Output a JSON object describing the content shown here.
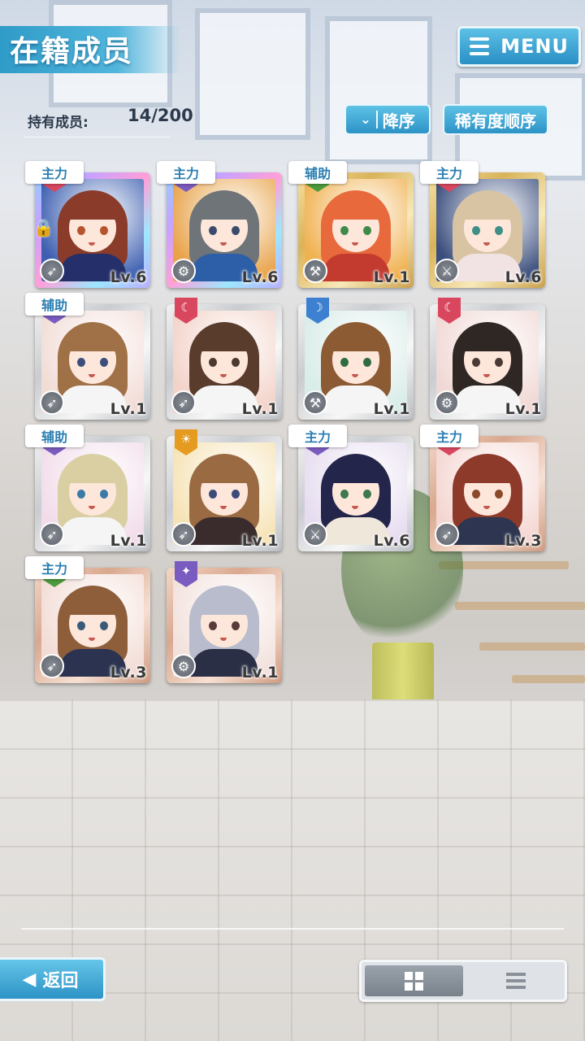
{
  "header": {
    "title": "在籍成员",
    "menu_label": "MENU",
    "owned_label": "持有成员:",
    "owned_count": "14/200",
    "sort_order_label": "降序",
    "sort_rarity_label": "稀有度顺序"
  },
  "members": [
    {
      "role": "主力",
      "level": "Lv.6",
      "frame": "rainbow",
      "attribute": "red",
      "weapon": "rocket-icon",
      "locked": true,
      "hair": "#8a3b2a",
      "eye": "#b5542d",
      "bg": "#3d5fb0",
      "outfit": "#25306a"
    },
    {
      "role": "主力",
      "level": "Lv.6",
      "frame": "rainbow",
      "attribute": "purple",
      "weapon": "gear-icon",
      "locked": false,
      "hair": "#6f7478",
      "eye": "#3b4b6b",
      "bg": "#e8a34a",
      "outfit": "#2d5fa8"
    },
    {
      "role": "辅助",
      "level": "Lv.1",
      "frame": "gold",
      "attribute": "green",
      "weapon": "hammer-icon",
      "locked": false,
      "hair": "#e86a3c",
      "eye": "#3e8a4a",
      "bg": "#f0b150",
      "outfit": "#c33b2f"
    },
    {
      "role": "主力",
      "level": "Lv.6",
      "frame": "gold",
      "attribute": "red",
      "weapon": "sword-icon",
      "locked": false,
      "hair": "#d8c4a2",
      "eye": "#3f8f86",
      "bg": "#3a4e7d",
      "outfit": "#f1e3e3"
    },
    {
      "role": "辅助",
      "level": "Lv.1",
      "frame": "silver",
      "attribute": "purple",
      "weapon": "rocket-icon",
      "locked": false,
      "hair": "#a07047",
      "eye": "#3d4e7c",
      "bg": "#f2dcd6",
      "outfit": "#f5f5f5"
    },
    {
      "role": "",
      "level": "Lv.1",
      "frame": "silver",
      "attribute": "red",
      "weapon": "rocket-icon",
      "locked": false,
      "hair": "#5a3c2d",
      "eye": "#4a3a32",
      "bg": "#f3d3c9",
      "outfit": "#f5f5f5"
    },
    {
      "role": "",
      "level": "Lv.1",
      "frame": "silver",
      "attribute": "blue",
      "weapon": "hammer-icon",
      "locked": false,
      "hair": "#8c5a33",
      "eye": "#2e6c3f",
      "bg": "#d8ece8",
      "outfit": "#f5f5f5"
    },
    {
      "role": "",
      "level": "Lv.1",
      "frame": "silver",
      "attribute": "red",
      "weapon": "gear-icon",
      "locked": false,
      "hair": "#2e2724",
      "eye": "#4b3a33",
      "bg": "#f0d8d4",
      "outfit": "#f5f5f5"
    },
    {
      "role": "辅助",
      "level": "Lv.1",
      "frame": "silver",
      "attribute": "purple",
      "weapon": "rocket-icon",
      "locked": false,
      "hair": "#d9cfa2",
      "eye": "#3b7aa8",
      "bg": "#f2dcea",
      "outfit": "#f5f5f5"
    },
    {
      "role": "",
      "level": "Lv.1",
      "frame": "silver",
      "attribute": "orange",
      "weapon": "rocket-icon",
      "locked": false,
      "hair": "#9a6a43",
      "eye": "#3b4b7a",
      "bg": "#f6e3b5",
      "outfit": "#3a2c2c"
    },
    {
      "role": "主力",
      "level": "Lv.6",
      "frame": "silver",
      "attribute": "purple",
      "weapon": "sword-icon",
      "locked": false,
      "hair": "#23264a",
      "eye": "#3c7a4e",
      "bg": "#e6dcf0",
      "outfit": "#efe7d9"
    },
    {
      "role": "主力",
      "level": "Lv.3",
      "frame": "bronze",
      "attribute": "red",
      "weapon": "rocket-icon",
      "locked": false,
      "hair": "#8e3a2a",
      "eye": "#8a4a2a",
      "bg": "#f4d6d1",
      "outfit": "#2d3550"
    },
    {
      "role": "主力",
      "level": "Lv.3",
      "frame": "bronze",
      "attribute": "green",
      "weapon": "rocket-icon",
      "locked": false,
      "hair": "#8e5e3a",
      "eye": "#3a5a7a",
      "bg": "#f3dcd5",
      "outfit": "#2b3350"
    },
    {
      "role": "",
      "level": "Lv.1",
      "frame": "bronze",
      "attribute": "purple",
      "weapon": "gear-icon",
      "locked": false,
      "hair": "#b8bccc",
      "eye": "#5a3a3a",
      "bg": "#f2e1dc",
      "outfit": "#2a2f45"
    }
  ],
  "footer": {
    "back_label": "返回",
    "view_mode": "grid"
  }
}
